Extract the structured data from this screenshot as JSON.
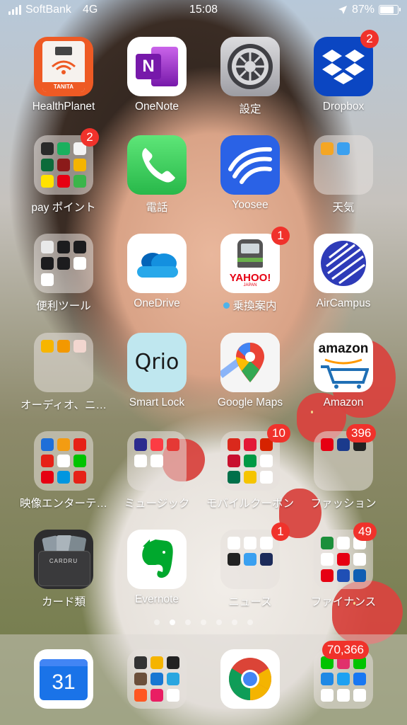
{
  "status_bar": {
    "carrier": "SoftBank",
    "network": "4G",
    "time": "15:08",
    "battery_pct": "87%",
    "battery_level": 0.87
  },
  "apps": {
    "healthplanet": {
      "label": "HealthPlanet",
      "icon": "scale-icon",
      "color": "#ee5a24"
    },
    "onenote": {
      "label": "OneNote",
      "icon": "onenote-icon",
      "color": "#7b2fbe"
    },
    "settings": {
      "label": "設定",
      "icon": "gear-icon",
      "color": "#8e8e93"
    },
    "dropbox": {
      "label": "Dropbox",
      "icon": "dropbox-icon",
      "badge": "2",
      "color": "#0b46c2"
    },
    "pay_folder": {
      "label": "pay ポイント",
      "badge": "2"
    },
    "phone": {
      "label": "電話",
      "icon": "phone-icon",
      "color": "#34c759"
    },
    "yoosee": {
      "label": "Yoosee",
      "icon": "yoosee-icon",
      "color": "#2a62e6"
    },
    "weather_folder": {
      "label": "天気"
    },
    "tools_folder": {
      "label": "便利ツール"
    },
    "onedrive": {
      "label": "OneDrive",
      "icon": "cloud-icon",
      "color": "#0f78d4"
    },
    "norikae": {
      "label": "乗換案内",
      "icon": "train-icon",
      "badge": "1",
      "new_dot": true,
      "brand_text": "YAHOO!",
      "brand_sub": "JAPAN"
    },
    "aircampus": {
      "label": "AirCampus",
      "icon": "aircampus-icon",
      "color": "#2e3bb8"
    },
    "audio_folder": {
      "label": "オーディオ、ニ…"
    },
    "smartlock": {
      "label": "Smart Lock",
      "icon": "qrio-icon",
      "icon_text": "Qrio",
      "color": "#bfe7ef"
    },
    "googlemaps": {
      "label": "Google Maps",
      "icon": "map-pin-icon"
    },
    "amazon": {
      "label": "Amazon",
      "icon": "cart-icon",
      "icon_text": "amazon"
    },
    "video_folder": {
      "label": "映像エンターテ…"
    },
    "music_folder": {
      "label": "ミュージック"
    },
    "coupon_folder": {
      "label": "モバイルクーポン",
      "badge": "10"
    },
    "fashion_folder": {
      "label": "ファッション",
      "badge": "396"
    },
    "cards": {
      "label": "カード類",
      "icon": "wallet-icon",
      "icon_text": "CARDRU"
    },
    "evernote": {
      "label": "Evernote",
      "icon": "elephant-icon",
      "color": "#00a82d"
    },
    "news_folder": {
      "label": "ニュース",
      "badge": "1"
    },
    "finance_folder": {
      "label": "ファイナンス",
      "badge": "49"
    }
  },
  "page_indicator": {
    "count": 7,
    "current": 1
  },
  "dock": {
    "calendar": {
      "icon": "calendar-icon",
      "icon_text": "31"
    },
    "photo_folder": {
      "icon": "folder-icon"
    },
    "chrome": {
      "icon": "chrome-icon"
    },
    "social_folder": {
      "icon": "folder-icon",
      "badge": "70,366"
    }
  }
}
